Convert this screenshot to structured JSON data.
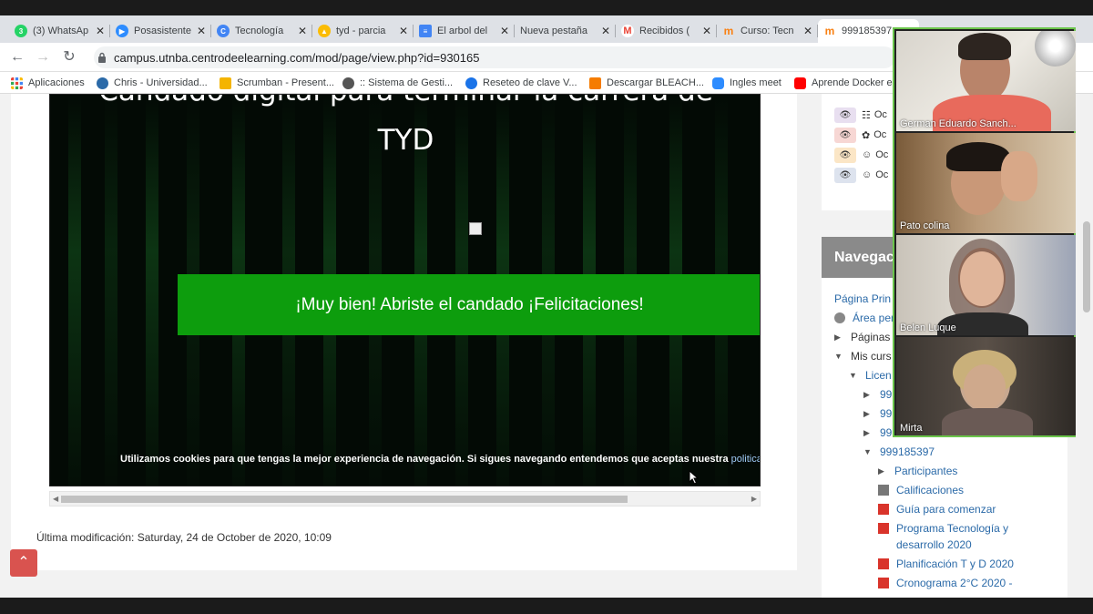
{
  "browser": {
    "tabs": [
      {
        "label": "(3) WhatsAp",
        "fav": "#25d366",
        "glyph": "3"
      },
      {
        "label": "Posasistente",
        "fav": "#2d8cff",
        "glyph": "▶"
      },
      {
        "label": "Tecnología",
        "fav": "#4285f4",
        "glyph": "C"
      },
      {
        "label": "tyd - parcia",
        "fav": "#fbbc04",
        "glyph": "▲"
      },
      {
        "label": "El arbol del",
        "fav": "#4285f4",
        "glyph": "≡"
      },
      {
        "label": "Nueva pestaña",
        "fav": "",
        "glyph": ""
      },
      {
        "label": "Recibidos (",
        "fav": "#ea4335",
        "glyph": "M"
      },
      {
        "label": "Curso: Tecn",
        "fav": "#f98012",
        "glyph": "m"
      },
      {
        "label": "999185397",
        "fav": "#f98012",
        "glyph": "m"
      }
    ],
    "close_glyph": "✕",
    "url": "campus.utnba.centrodeelearning.com/mod/page/view.php?id=930165",
    "bookmarks": [
      {
        "label": "Aplicaciones",
        "color": "#ea4335"
      },
      {
        "label": "Chris - Universidad...",
        "color": "#2b6aa8"
      },
      {
        "label": "Scrumban - Present...",
        "color": "#f4b400"
      },
      {
        "label": ":: Sistema de Gesti...",
        "color": "#555555"
      },
      {
        "label": "Reseteo de clave V...",
        "color": "#1a73e8"
      },
      {
        "label": "Descargar BLEACH...",
        "color": "#f57c00"
      },
      {
        "label": "Ingles meet",
        "color": "#2d8cff"
      },
      {
        "label": "Aprende Docker er",
        "color": "#ff0000"
      }
    ]
  },
  "content": {
    "title_line1": "Candado digital para terminar la carrera de",
    "title_line2": "TYD",
    "success_message": "¡Muy bien! Abriste el candado ¡Felicitaciones!",
    "cookie_text": "Utilizamos cookies para que tengas la mejor experiencia de navegación. Si sigues navegando entendemos que aceptas nuestra ",
    "cookie_link": "politica de",
    "last_modified": "Última modificación: Saturday, 24 de October de 2020, 10:09",
    "to_top": "⌃"
  },
  "sidebar": {
    "activities": [
      {
        "label": "Oc",
        "eye_color": "#e8dff0"
      },
      {
        "label": "Oc",
        "eye_color": "#f7d7d4"
      },
      {
        "label": "Oc",
        "eye_color": "#fbe6c6"
      },
      {
        "label": "Oc",
        "eye_color": "#dde3ee"
      }
    ],
    "nav_title": "Navegac",
    "nav": {
      "home": "Página Prin",
      "personal": "Área per",
      "pages": "Páginas",
      "my_courses": "Mis curs",
      "degree": "Licen",
      "c1": "999",
      "c2": "999",
      "c3": "999",
      "course": "999185397",
      "participants": "Participantes",
      "grades": "Calificaciones",
      "guide": "Guía para comenzar",
      "program1": "Programa Tecnología y",
      "program2": "desarrollo 2020",
      "planning": "Planificación T y D 2020",
      "schedule": "Cronograma 2°C 2020 -"
    }
  },
  "participants": [
    {
      "name": "German Eduardo Sanch..."
    },
    {
      "name": "Pato colina"
    },
    {
      "name": "Belen Luque"
    },
    {
      "name": "Mirta"
    }
  ]
}
